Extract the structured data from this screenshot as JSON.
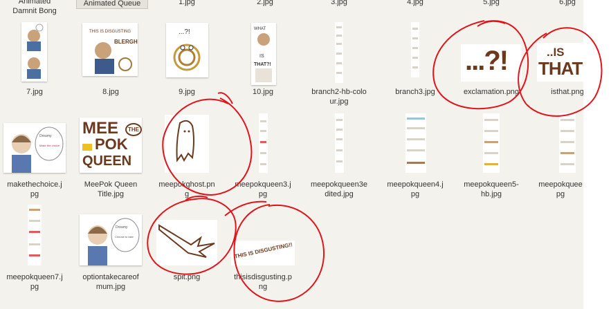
{
  "top_row": {
    "folder_label": "Animated\nDamnit Bong",
    "queue_button": "Animated Queue",
    "files": [
      "1.jpg",
      "2.jpg",
      "3.jpg",
      "4.jpg",
      "5.jpg",
      "6.jpg"
    ]
  },
  "row1": [
    {
      "label": "7.jpg",
      "icon": "comic-strip-thumb"
    },
    {
      "label": "8.jpg",
      "icon": "illustration-thumb"
    },
    {
      "label": "9.jpg",
      "icon": "noodle-drawing-thumb"
    },
    {
      "label": "10.jpg",
      "icon": "comic-character-thumb"
    },
    {
      "label": "branch2-hb-colo\nur.jpg",
      "icon": "tall-strip-thumb"
    },
    {
      "label": "branch3.jpg",
      "icon": "tall-strip-thumb"
    },
    {
      "label": "exclamation.png",
      "icon": "exclamation-text-thumb",
      "thumb_text": "...?!"
    },
    {
      "label": "isthat.png",
      "icon": "isthat-text-thumb",
      "thumb_text_a": "..IS",
      "thumb_text_b": "THAT?"
    }
  ],
  "row2": [
    {
      "label": "makethechoice.j\npg",
      "icon": "character-thumb"
    },
    {
      "label": "MeePok Queen\nTitle.jpg",
      "icon": "title-text-thumb",
      "thumb_text_a": "MEE",
      "thumb_text_b": "POK",
      "thumb_text_c": "QUEEN",
      "thumb_text_d": "THE"
    },
    {
      "label": "meepokghost.pn\ng",
      "icon": "ghost-drawing-thumb"
    },
    {
      "label": "meepokqueen3.j\npg",
      "icon": "tall-strip-thumb"
    },
    {
      "label": "meepokqueen3e\ndited.jpg",
      "icon": "tall-strip-thumb"
    },
    {
      "label": "meepokqueen4.j\npg",
      "icon": "tall-strip-thumb"
    },
    {
      "label": "meepokqueen5-\nhb.jpg",
      "icon": "tall-strip-thumb"
    },
    {
      "label": "meepokquee\npg",
      "icon": "tall-strip-thumb"
    }
  ],
  "row3": [
    {
      "label": "meepokqueen7.j\npg",
      "icon": "tall-strip-thumb"
    },
    {
      "label": "optiontakecareof\nmum.jpg",
      "icon": "character-thumb"
    },
    {
      "label": "spit.png",
      "icon": "spit-drawing-thumb"
    },
    {
      "label": "thisisdisgusting.p\nng",
      "icon": "disgusting-text-thumb",
      "thumb_text": "THIS IS DISGUSTING!!"
    }
  ],
  "colors": {
    "background": "#f4f2ec",
    "annotation": "#e0141b",
    "ink": "#6b3a1e"
  }
}
